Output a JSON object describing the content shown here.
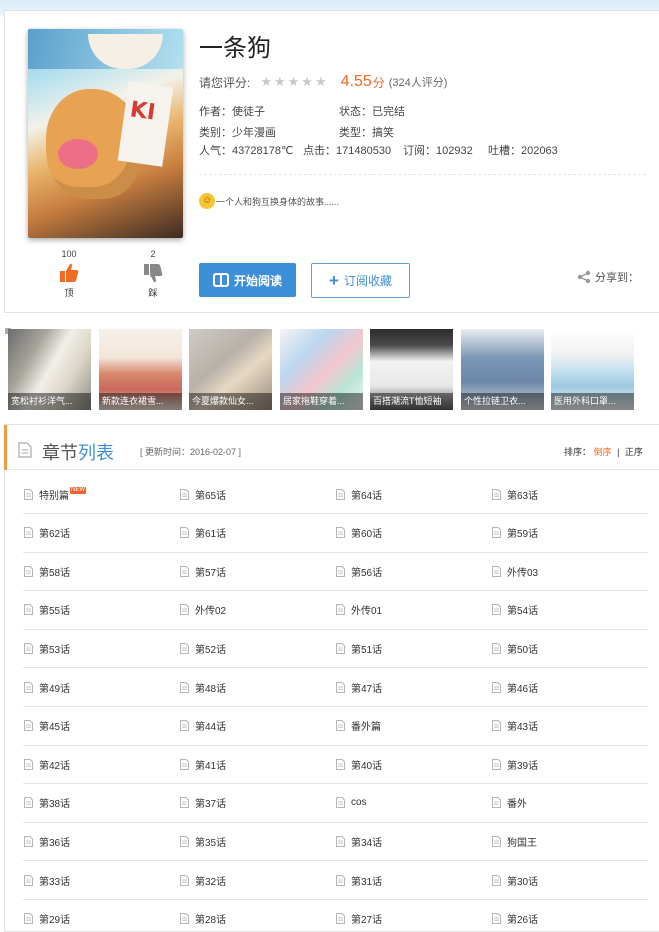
{
  "comic": {
    "title": "一条狗",
    "rating_label": "请您评分:",
    "stars": "★★★★★",
    "score": "4.55",
    "score_unit": "分",
    "rating_count": "(324人评分)",
    "author": "作者：使徒子",
    "status": "状态：已完结",
    "category": "类别：少年漫画",
    "type": "类型：搞笑",
    "popularity": "人气：43728178℃",
    "clicks": "点击：171480530",
    "subscriptions": "订阅：102932",
    "comments": "吐槽：202063",
    "description": "一个人和狗互换身体的故事......"
  },
  "votes": {
    "up_count": "100",
    "up_label": "顶",
    "down_count": "2",
    "down_label": "踩"
  },
  "actions": {
    "read_label": "开始阅读",
    "subscribe_label": "订阅收藏",
    "share_label": "分享到："
  },
  "ads": [
    {
      "caption": "宽松衬衫洋气..."
    },
    {
      "caption": "新款连衣裙雪..."
    },
    {
      "caption": "今夏爆款仙女..."
    },
    {
      "caption": "居家拖鞋穿着..."
    },
    {
      "caption": "百搭潮流T恤短袖"
    },
    {
      "caption": "个性拉链卫衣..."
    },
    {
      "caption": "医用外科口罩..."
    }
  ],
  "chapter_list": {
    "title_a": "章节",
    "title_b": "列表",
    "updated": "[ 更新时间：2016-02-07 ]",
    "sort_label": "排序：",
    "sort_desc": "倒序",
    "sort_sep": "|",
    "sort_asc": "正序",
    "new_badge": "NEW",
    "chapters": [
      "特别篇",
      "第65话",
      "第64话",
      "第63话",
      "第62话",
      "第61话",
      "第60话",
      "第59话",
      "第58话",
      "第57话",
      "第56话",
      "外传03",
      "第55话",
      "外传02",
      "外传01",
      "第54话",
      "第53话",
      "第52话",
      "第51话",
      "第50话",
      "第49话",
      "第48话",
      "第47话",
      "第46话",
      "第45话",
      "第44话",
      "番外篇",
      "第43话",
      "第42话",
      "第41话",
      "第40话",
      "第39话",
      "第38话",
      "第37话",
      "cos",
      "番外",
      "第36话",
      "第35话",
      "第34话",
      "狗国王",
      "第33话",
      "第32话",
      "第31话",
      "第30话",
      "第29话",
      "第28话",
      "第27话",
      "第26话"
    ]
  },
  "colors": {
    "accent_blue": "#3d8fd8",
    "accent_orange": "#f06b23",
    "section_bar": "#f29b3a"
  }
}
